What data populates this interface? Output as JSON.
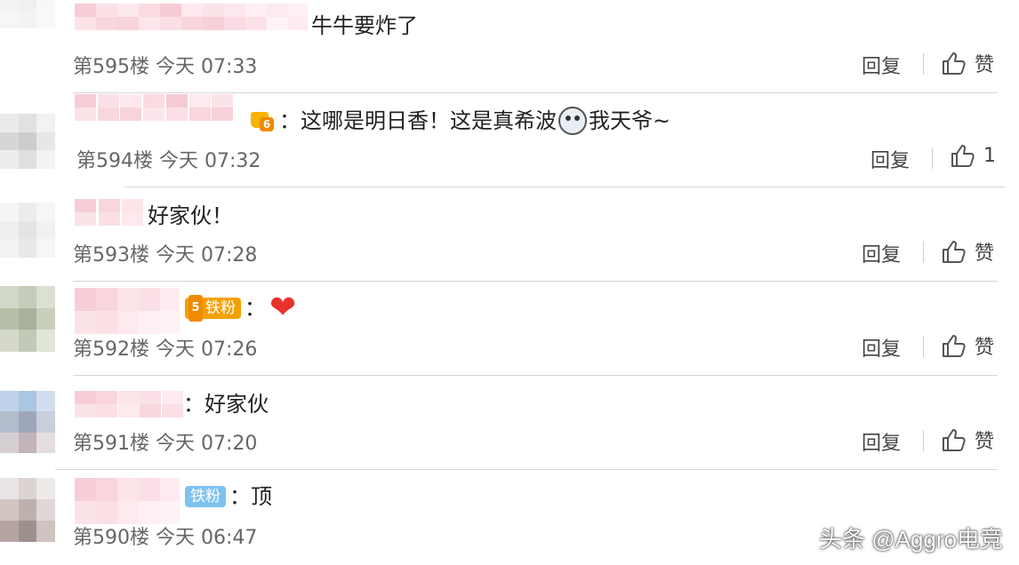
{
  "comments": [
    {
      "text": "牛牛要炸了",
      "prefix": "",
      "floor": "第595楼",
      "time": "今天 07:33",
      "reply": "回复",
      "like": "赞"
    },
    {
      "prefix": "：",
      "text_part1": "这哪是明日香！这是真希波",
      "text_part2": "我天爷~",
      "crown_level": "6",
      "floor": "第594楼",
      "time": "今天 07:32",
      "reply": "回复",
      "like_count": "1"
    },
    {
      "text": "好家伙！",
      "floor": "第593楼",
      "time": "今天 07:28",
      "reply": "回复",
      "like": "赞"
    },
    {
      "prefix": "：",
      "badge_level": "5",
      "badge_label": "铁粉",
      "floor": "第592楼",
      "time": "今天 07:26",
      "reply": "回复",
      "like": "赞"
    },
    {
      "prefix": "：",
      "text": "好家伙",
      "floor": "第591楼",
      "time": "今天 07:20",
      "reply": "回复",
      "like": "赞"
    },
    {
      "prefix": "：",
      "text": "顶",
      "badge_label": "铁粉",
      "floor": "第590楼",
      "time": "今天 06:47"
    }
  ],
  "watermark": "头条 @Aggro电竞",
  "colors": {
    "heart": "#e8332a",
    "fan_gold": "#f5a000",
    "fan_blue": "#7ec2f0",
    "divider": "#d6d6d6"
  },
  "icons": [
    "thumbs-up-icon",
    "heart-emoji",
    "crown-level-icon",
    "shocked-face-emoji"
  ]
}
